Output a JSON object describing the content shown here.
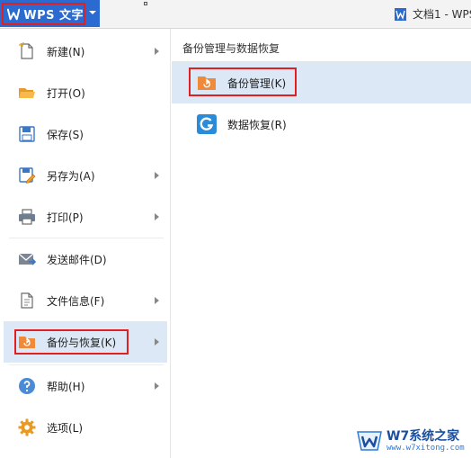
{
  "app": {
    "title": "WPS 文字",
    "brand_color": "#2a6ad1"
  },
  "document_tab": {
    "label": "文档1 - WPS"
  },
  "left_menu": {
    "items": [
      {
        "label": "新建(N)",
        "icon": "new-document-icon",
        "has_submenu": true
      },
      {
        "label": "打开(O)",
        "icon": "folder-open-icon",
        "has_submenu": false
      },
      {
        "label": "保存(S)",
        "icon": "save-icon",
        "has_submenu": false
      },
      {
        "label": "另存为(A)",
        "icon": "save-as-icon",
        "has_submenu": true
      },
      {
        "label": "打印(P)",
        "icon": "printer-icon",
        "has_submenu": true
      },
      {
        "label": "发送邮件(D)",
        "icon": "mail-icon",
        "has_submenu": false
      },
      {
        "label": "文件信息(F)",
        "icon": "file-info-icon",
        "has_submenu": true
      },
      {
        "label": "备份与恢复(K)",
        "icon": "backup-folder-icon",
        "has_submenu": true,
        "active": true
      },
      {
        "label": "帮助(H)",
        "icon": "help-icon",
        "has_submenu": true
      },
      {
        "label": "选项(L)",
        "icon": "gear-icon",
        "has_submenu": false
      }
    ]
  },
  "right_panel": {
    "title": "备份管理与数据恢复",
    "items": [
      {
        "label": "备份管理(K)",
        "icon": "backup-folder-icon",
        "active": true
      },
      {
        "label": "数据恢复(R)",
        "icon": "data-recovery-icon",
        "active": false
      }
    ]
  },
  "watermark": {
    "main": "W7系统之家",
    "sub": "www.w7xitong.com"
  },
  "colors": {
    "highlight_red": "#e02020",
    "active_bg": "#dce8f6"
  }
}
